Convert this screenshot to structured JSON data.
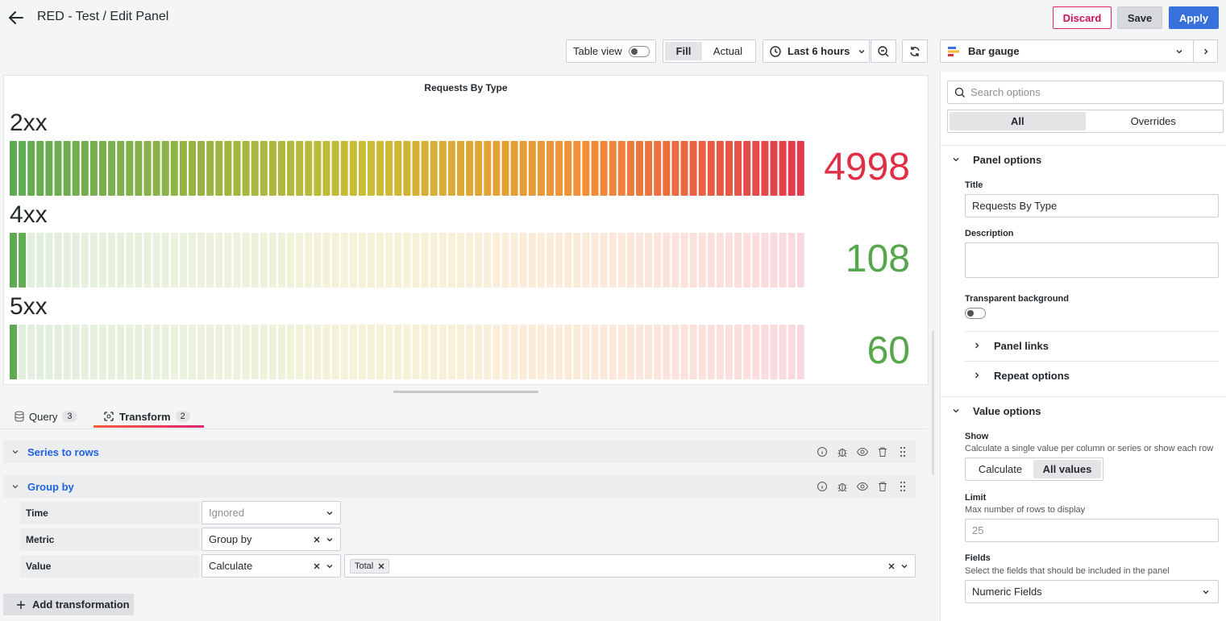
{
  "header": {
    "title": "RED - Test / Edit Panel",
    "discard": "Discard",
    "save": "Save",
    "apply": "Apply"
  },
  "toolbar": {
    "table_view": "Table view",
    "fill": "Fill",
    "actual": "Actual",
    "time_range": "Last 6 hours",
    "visualization": "Bar gauge"
  },
  "panel": {
    "title": "Requests By Type",
    "gauges": [
      {
        "label": "2xx",
        "value": "4998",
        "fill": 1.0,
        "color": "#e02f44"
      },
      {
        "label": "4xx",
        "value": "108",
        "fill": 0.02,
        "color": "#56a64b"
      },
      {
        "label": "5xx",
        "value": "60",
        "fill": 0.012,
        "color": "#56a64b"
      }
    ]
  },
  "editor": {
    "tabs": [
      {
        "label": "Query",
        "count": "3"
      },
      {
        "label": "Transform",
        "count": "2"
      }
    ],
    "transformations": [
      {
        "name": "Series to rows"
      },
      {
        "name": "Group by"
      }
    ],
    "fields": [
      {
        "label": "Time",
        "select": "Ignored"
      },
      {
        "label": "Metric",
        "select": "Group by"
      },
      {
        "label": "Value",
        "select": "Calculate",
        "tag": "Total"
      }
    ],
    "add_transformation": "Add transformation"
  },
  "options": {
    "search_placeholder": "Search options",
    "tab_all": "All",
    "tab_overrides": "Overrides",
    "panel_options": "Panel options",
    "title_label": "Title",
    "title_value": "Requests By Type",
    "description_label": "Description",
    "transparent_label": "Transparent background",
    "panel_links": "Panel links",
    "repeat_options": "Repeat options",
    "value_options": "Value options",
    "show_label": "Show",
    "show_desc": "Calculate a single value per column or series or show each row",
    "calculate": "Calculate",
    "all_values": "All values",
    "limit_label": "Limit",
    "limit_desc": "Max number of rows to display",
    "limit_placeholder": "25",
    "fields_label": "Fields",
    "fields_desc": "Select the fields that should be included in the panel",
    "fields_value": "Numeric Fields"
  }
}
